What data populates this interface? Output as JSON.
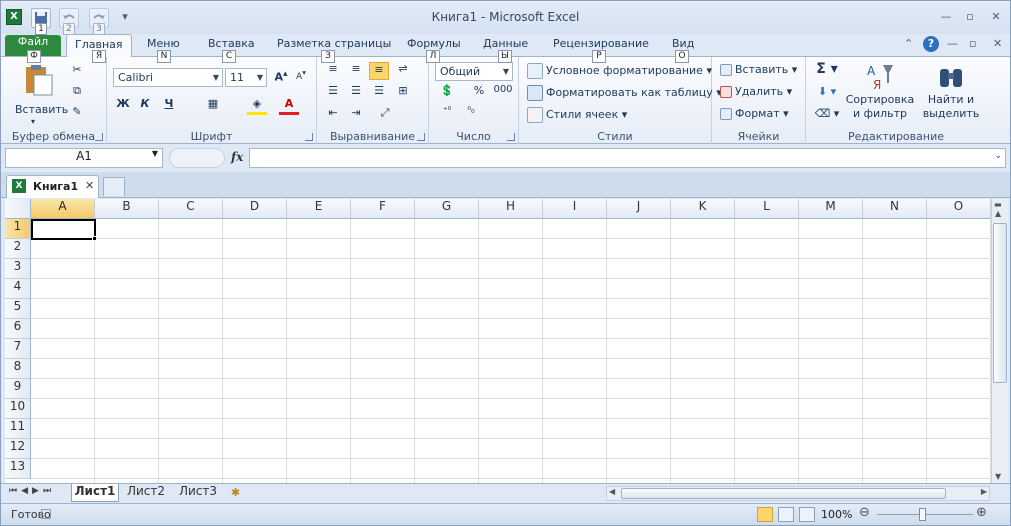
{
  "window": {
    "title": "Книга1 - Microsoft Excel"
  },
  "quick_access": {
    "keys": [
      "1",
      "2",
      "3"
    ]
  },
  "tabs": {
    "file": "Файл",
    "items": [
      {
        "label": "Главная",
        "key": "Я"
      },
      {
        "label": "Меню",
        "key": "N"
      },
      {
        "label": "Вставка",
        "key": "С"
      },
      {
        "label": "Разметка страницы",
        "key": "З"
      },
      {
        "label": "Формулы",
        "key": "Л"
      },
      {
        "label": "Данные",
        "key": "Ы"
      },
      {
        "label": "Рецензирование",
        "key": "Р"
      },
      {
        "label": "Вид",
        "key": "О"
      }
    ],
    "file_key": "Ф"
  },
  "ribbon": {
    "clipboard": {
      "label": "Буфер обмена",
      "paste": "Вставить"
    },
    "font": {
      "label": "Шрифт",
      "name": "Calibri",
      "size": "11",
      "bold": "Ж",
      "italic": "К",
      "underline": "Ч"
    },
    "alignment": {
      "label": "Выравнивание"
    },
    "number": {
      "label": "Число",
      "format": "Общий",
      "percent": "%",
      "thousands": "000"
    },
    "styles": {
      "label": "Стили",
      "conditional": "Условное форматирование",
      "as_table": "Форматировать как таблицу",
      "cell_styles": "Стили ячеек"
    },
    "cells": {
      "label": "Ячейки",
      "insert": "Вставить",
      "delete": "Удалить",
      "format": "Формат"
    },
    "editing": {
      "label": "Редактирование",
      "sum": "Σ",
      "sort_1": "Сортировка",
      "sort_2": "и фильтр",
      "find_1": "Найти и",
      "find_2": "выделить"
    }
  },
  "formula_bar": {
    "name_box": "A1",
    "fx": "fx",
    "value": ""
  },
  "workbook_tab": {
    "name": "Книга1"
  },
  "grid": {
    "columns": [
      "A",
      "B",
      "C",
      "D",
      "E",
      "F",
      "G",
      "H",
      "I",
      "J",
      "K",
      "L",
      "M",
      "N",
      "O"
    ],
    "rows": [
      "1",
      "2",
      "3",
      "4",
      "5",
      "6",
      "7",
      "8",
      "9",
      "10",
      "11",
      "12",
      "13"
    ],
    "active_cell": "A1"
  },
  "sheets": {
    "tabs": [
      "Лист1",
      "Лист2",
      "Лист3"
    ],
    "active": "Лист1"
  },
  "status": {
    "ready": "Готово",
    "zoom": "100%"
  },
  "colors": {
    "file_tab": "#2e8a3e",
    "selected_header": "#f3c96c",
    "accent": "#2a6fc0"
  }
}
